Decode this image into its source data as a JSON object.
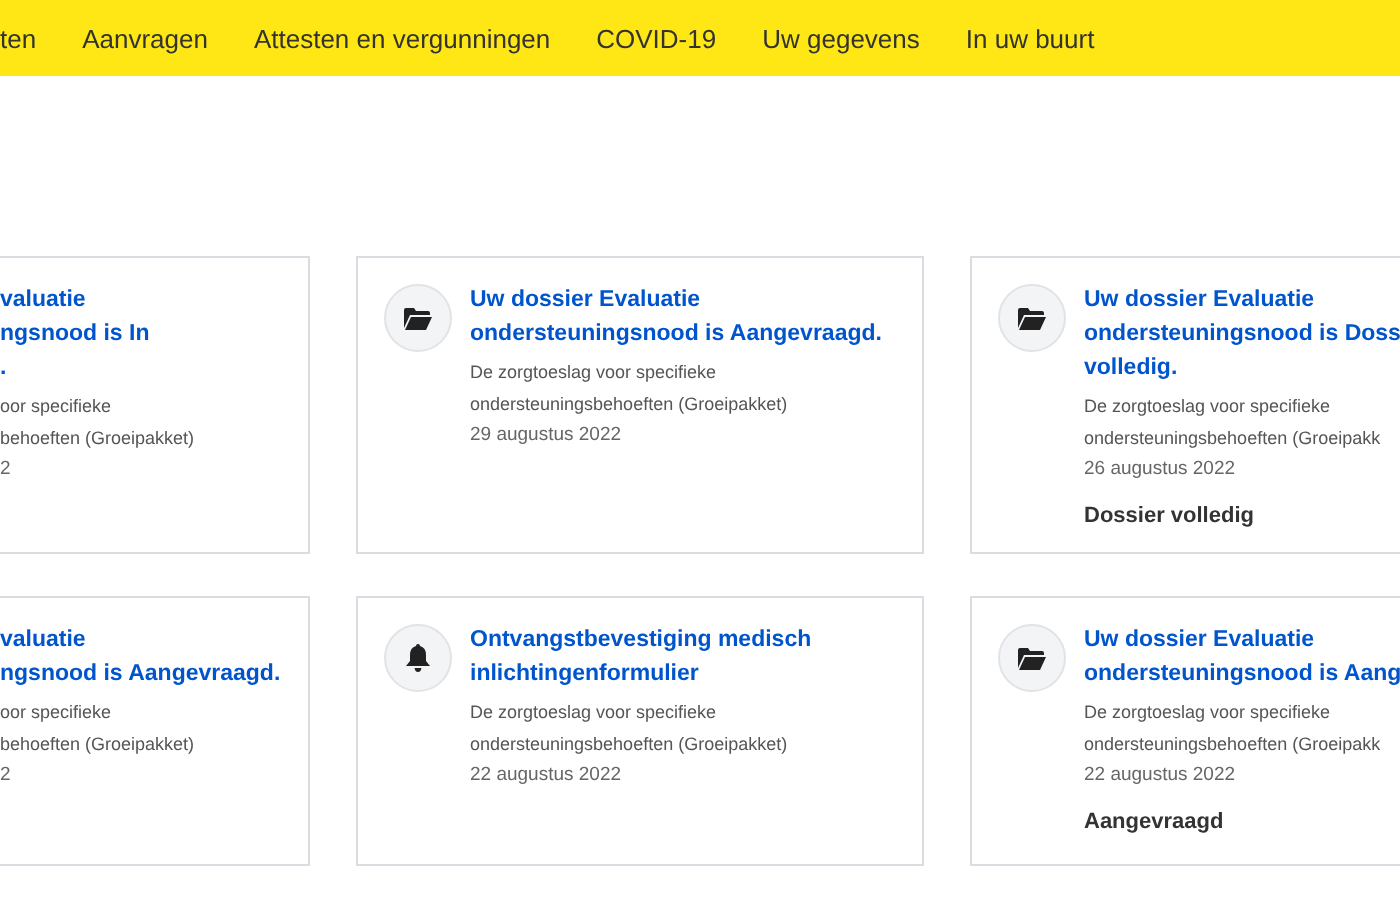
{
  "nav": {
    "items": [
      {
        "label": "ten"
      },
      {
        "label": "Aanvragen"
      },
      {
        "label": "Attesten en vergunningen"
      },
      {
        "label": "COVID-19"
      },
      {
        "label": "Uw gegevens"
      },
      {
        "label": "In uw buurt"
      }
    ]
  },
  "cards": [
    {
      "title": "valuatie\nngsnood is In\n.",
      "description": "oor specifieke\nbehoeften (Groeipakket)",
      "date": "2"
    },
    {
      "title": "Uw dossier Evaluatie\nondersteuningsnood is Aangevraagd.",
      "description": "De zorgtoeslag voor specifieke\nondersteuningsbehoeften (Groeipakket)",
      "date": "29 augustus 2022"
    },
    {
      "title": "Uw dossier Evaluatie\nondersteuningsnood is Doss\nvolledig.",
      "description": "De zorgtoeslag voor specifieke\nondersteuningsbehoeften (Groeipakk",
      "date": "26 augustus 2022",
      "status": "Dossier volledig"
    },
    {
      "title": "valuatie\nngsnood is Aangevraagd.",
      "description": "oor specifieke\nbehoeften (Groeipakket)",
      "date": "2"
    },
    {
      "title": "Ontvangstbevestiging medisch\ninlichtingenformulier",
      "description": "De zorgtoeslag voor specifieke\nondersteuningsbehoeften (Groeipakket)",
      "date": "22 augustus 2022"
    },
    {
      "title": "Uw dossier Evaluatie\nondersteuningsnood is Aang",
      "description": "De zorgtoeslag voor specifieke\nondersteuningsbehoeften (Groeipakk",
      "date": "22 augustus 2022",
      "status": "Aangevraagd"
    }
  ]
}
